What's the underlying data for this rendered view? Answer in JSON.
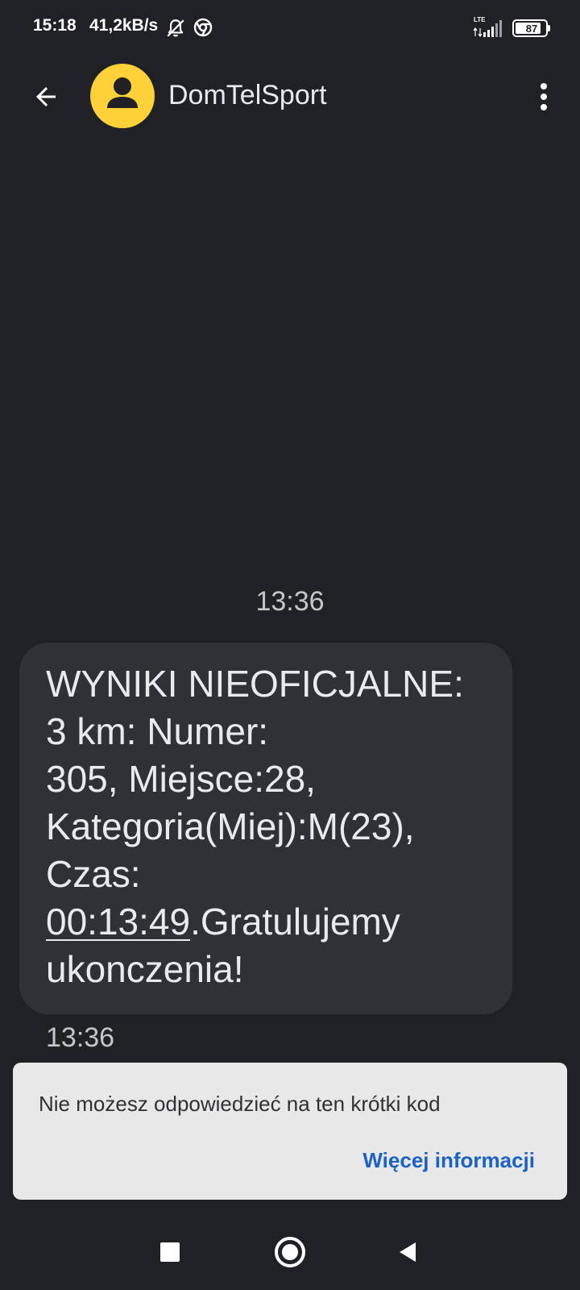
{
  "status_bar": {
    "time": "15:18",
    "net_speed": "41,2kB/s",
    "network_type": "LTE",
    "battery_level": "87",
    "battery_fraction": 0.87,
    "icons": [
      "bell-off-icon",
      "chrome-icon",
      "signal-icon",
      "battery-icon"
    ]
  },
  "header": {
    "contact_name": "DomTelSport",
    "avatar_color": "#fdd137"
  },
  "conversation": {
    "date_stamp": "13:36",
    "message": {
      "lines": [
        "WYNIKI NIEOFICJALNE:",
        "3 km: Numer:",
        "305, Miejsce:28,",
        "Kategoria(Miej):M(23),",
        "Czas:"
      ],
      "time_link": "00:13:49",
      "after_link": ".Gratulujemy",
      "last_line": "ukonczenia!",
      "timestamp": "13:36"
    }
  },
  "banner": {
    "text": "Nie możesz odpowiedzieć na ten krótki kod",
    "link_label": "Więcej informacji",
    "link_color": "#1a63c4"
  },
  "nav": {
    "icons": [
      "recents-icon",
      "home-icon",
      "back-icon"
    ]
  }
}
